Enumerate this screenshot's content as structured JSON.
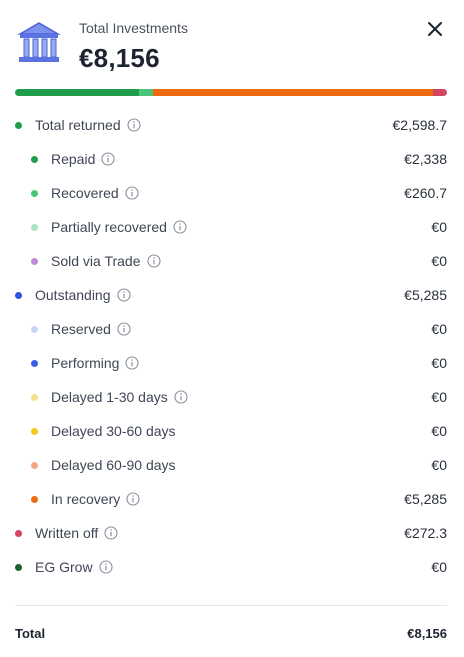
{
  "header": {
    "title": "Total Investments",
    "amount": "€8,156",
    "icon": "bank-icon",
    "close_icon": "close-icon"
  },
  "distribution": [
    {
      "name": "Total returned segment repaid",
      "fraction": 0.287,
      "color": "#1e9e4a"
    },
    {
      "name": "Recovered",
      "fraction": 0.032,
      "color": "#4cc47a"
    },
    {
      "name": "In recovery",
      "fraction": 0.648,
      "color": "#f06a0f"
    },
    {
      "name": "Written off",
      "fraction": 0.033,
      "color": "#d2445f"
    }
  ],
  "rows": [
    {
      "label": "Total returned",
      "value": "€2,598.7",
      "color": "#1e9e4a",
      "level": "top",
      "info": true,
      "key": "total-returned"
    },
    {
      "label": "Repaid",
      "value": "€2,338",
      "color": "#1e9e4a",
      "level": "sub",
      "info": true,
      "key": "repaid"
    },
    {
      "label": "Recovered",
      "value": "€260.7",
      "color": "#4cc47a",
      "level": "sub",
      "info": true,
      "key": "recovered"
    },
    {
      "label": "Partially recovered",
      "value": "€0",
      "color": "#a8e4bd",
      "level": "sub",
      "info": true,
      "key": "partially-recovered"
    },
    {
      "label": "Sold via Trade",
      "value": "€0",
      "color": "#c08ad8",
      "level": "sub",
      "info": true,
      "key": "sold-via-trade"
    },
    {
      "label": "Outstanding",
      "value": "€5,285",
      "color": "#2f4fe0",
      "level": "top",
      "info": true,
      "key": "outstanding"
    },
    {
      "label": "Reserved",
      "value": "€0",
      "color": "#c9d3f5",
      "level": "sub",
      "info": true,
      "key": "reserved"
    },
    {
      "label": "Performing",
      "value": "€0",
      "color": "#3b5ce6",
      "level": "sub",
      "info": true,
      "key": "performing"
    },
    {
      "label": "Delayed 1-30 days",
      "value": "€0",
      "color": "#f7e08f",
      "level": "sub",
      "info": true,
      "key": "delayed-1-30"
    },
    {
      "label": "Delayed 30-60 days",
      "value": "€0",
      "color": "#f2c81d",
      "level": "sub",
      "info": false,
      "key": "delayed-30-60"
    },
    {
      "label": "Delayed 60-90 days",
      "value": "€0",
      "color": "#f2a882",
      "level": "sub",
      "info": false,
      "key": "delayed-60-90"
    },
    {
      "label": "In recovery",
      "value": "€5,285",
      "color": "#f06a0f",
      "level": "sub",
      "info": true,
      "key": "in-recovery"
    },
    {
      "label": "Written off",
      "value": "€272.3",
      "color": "#d2445f",
      "level": "top",
      "info": true,
      "key": "written-off"
    },
    {
      "label": "EG Grow",
      "value": "€0",
      "color": "#1d5e34",
      "level": "top",
      "info": true,
      "key": "eg-grow"
    }
  ],
  "total": {
    "label": "Total",
    "value": "€8,156"
  }
}
